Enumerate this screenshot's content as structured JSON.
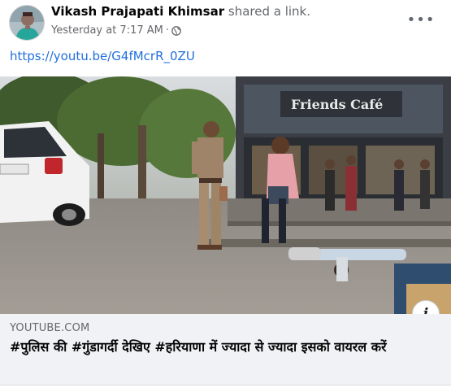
{
  "post": {
    "author_name": "Vikash Prajapati Khimsar",
    "action_text": "shared a link.",
    "timestamp": "Yesterday at 7:17 AM",
    "separator": "·",
    "privacy_icon": "globe-icon",
    "more_icon": "more-options-icon",
    "more_label": "•••",
    "link_text": "https://youtu.be/G4fMcrR_0ZU",
    "colors": {
      "link": "#216fdb",
      "secondary_text": "#65676b",
      "card_background": "#f0f2f5"
    }
  },
  "preview": {
    "sign_text": "Friends Café",
    "info_label": "i"
  },
  "link_card": {
    "domain": "YOUTUBE.COM",
    "title": "#पुलिस की #गुंडागर्दी देखिए #हरियाणा में ज्यादा से ज्यादा इसको वायरल करें"
  }
}
